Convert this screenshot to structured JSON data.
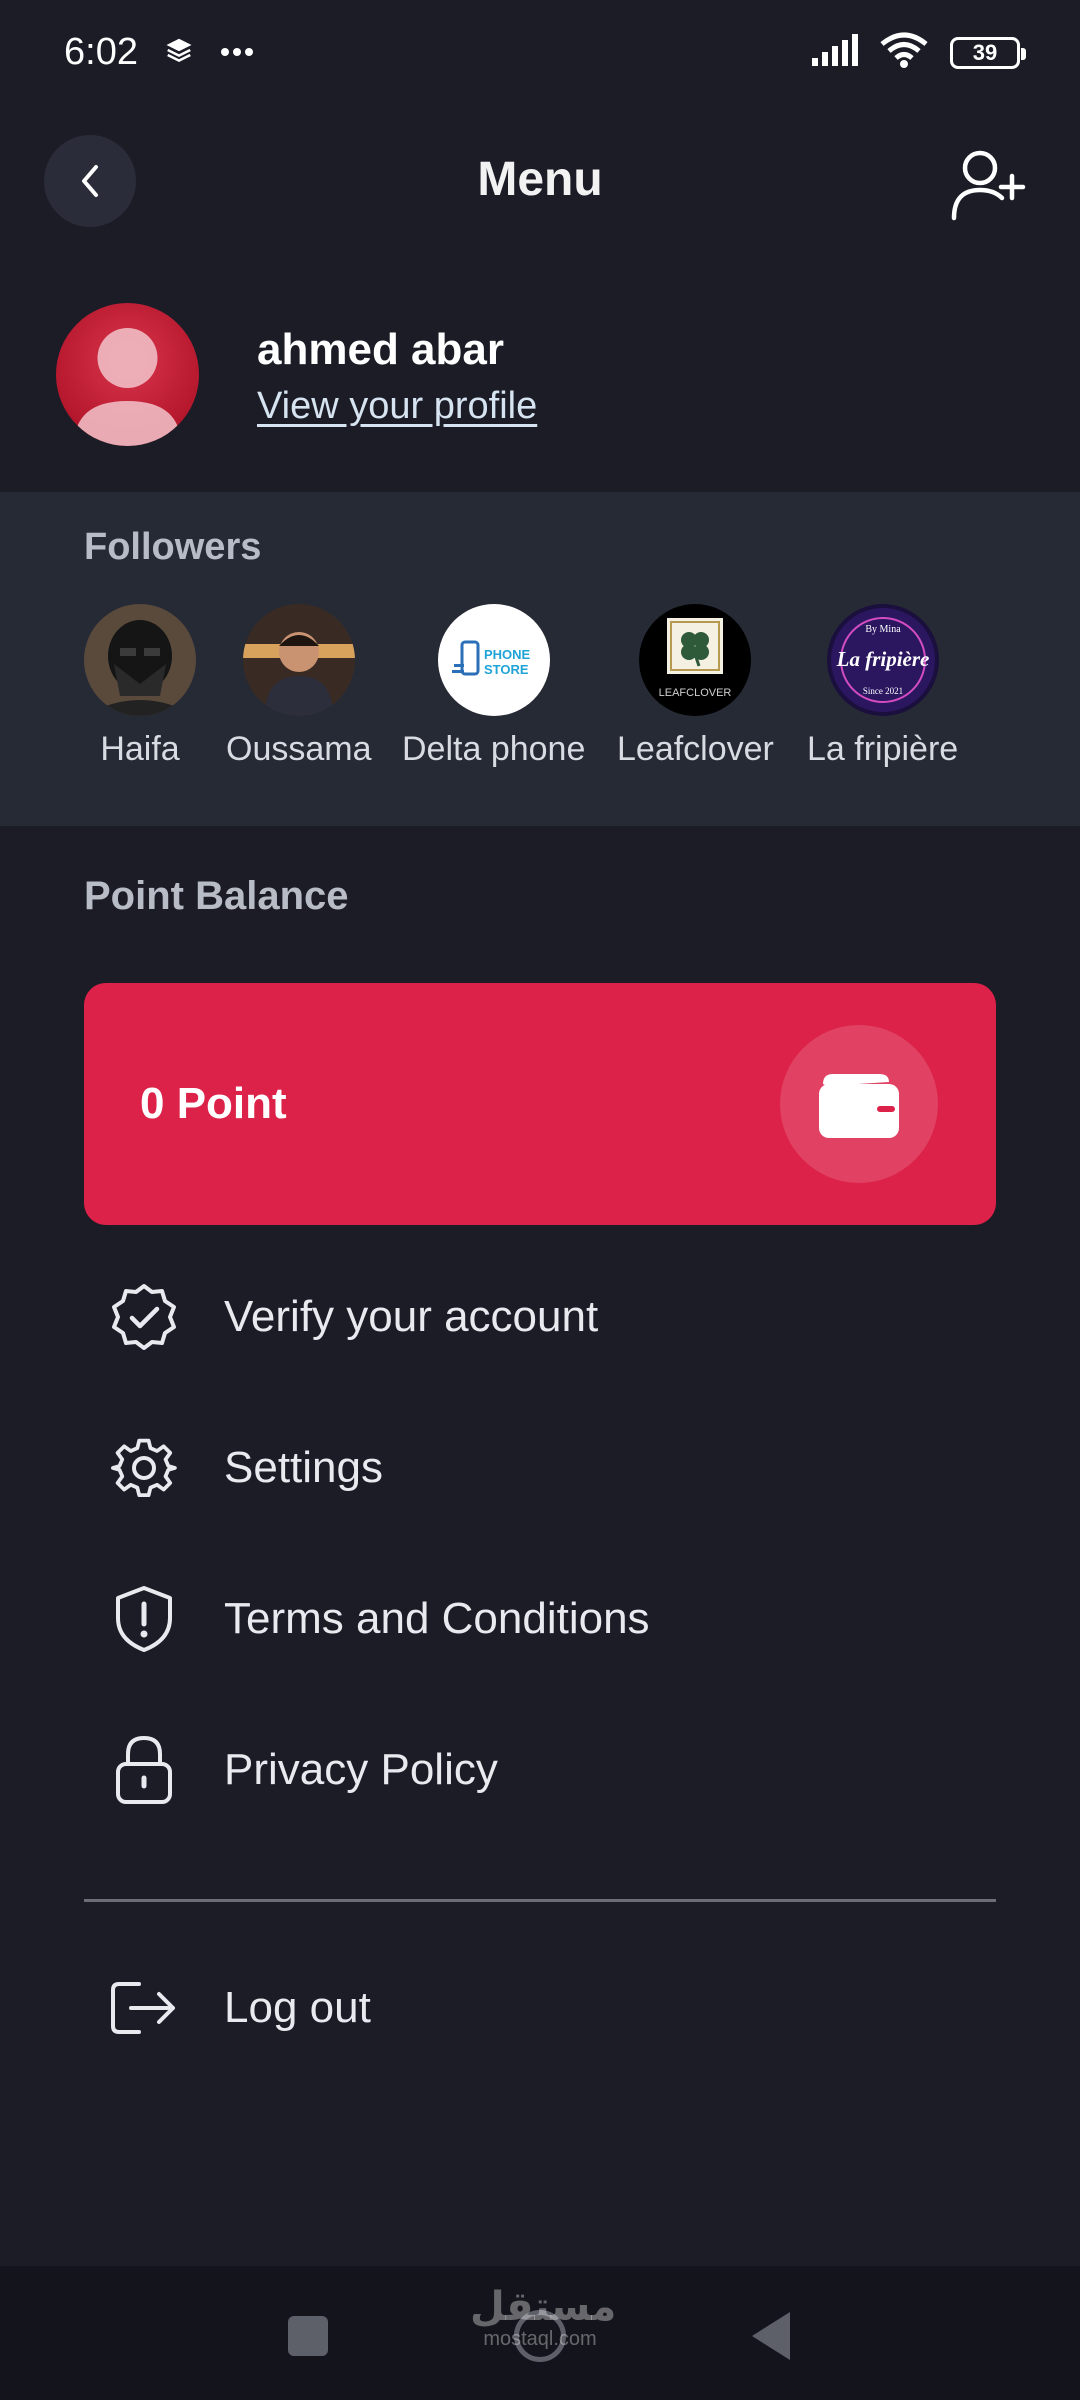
{
  "status_bar": {
    "time": "6:02",
    "battery": "39"
  },
  "header": {
    "title": "Menu"
  },
  "profile": {
    "name": "ahmed abar",
    "link": "View your profile"
  },
  "followers": {
    "title": "Followers",
    "items": [
      {
        "name": "Haifa"
      },
      {
        "name": "Oussama"
      },
      {
        "name": "Delta phone",
        "logo_line1": "PHONE",
        "logo_line2": "STORE"
      },
      {
        "name": "Leafclover",
        "logo_text": "LEAFCLOVER"
      },
      {
        "name": "La fripière",
        "logo_top": "By Mina",
        "logo_main": "La fripière",
        "logo_bottom": "Since 2021"
      }
    ]
  },
  "points": {
    "title": "Point Balance",
    "value": "0 Point"
  },
  "menu": {
    "verify": "Verify your account",
    "settings": "Settings",
    "terms": "Terms and Conditions",
    "privacy": "Privacy Policy",
    "logout": "Log out"
  },
  "watermark": {
    "arabic": "مستقل",
    "latin": "mostaql.com"
  },
  "colors": {
    "background": "#1c1c27",
    "accent": "#dc2249",
    "panel": "#262a35"
  }
}
